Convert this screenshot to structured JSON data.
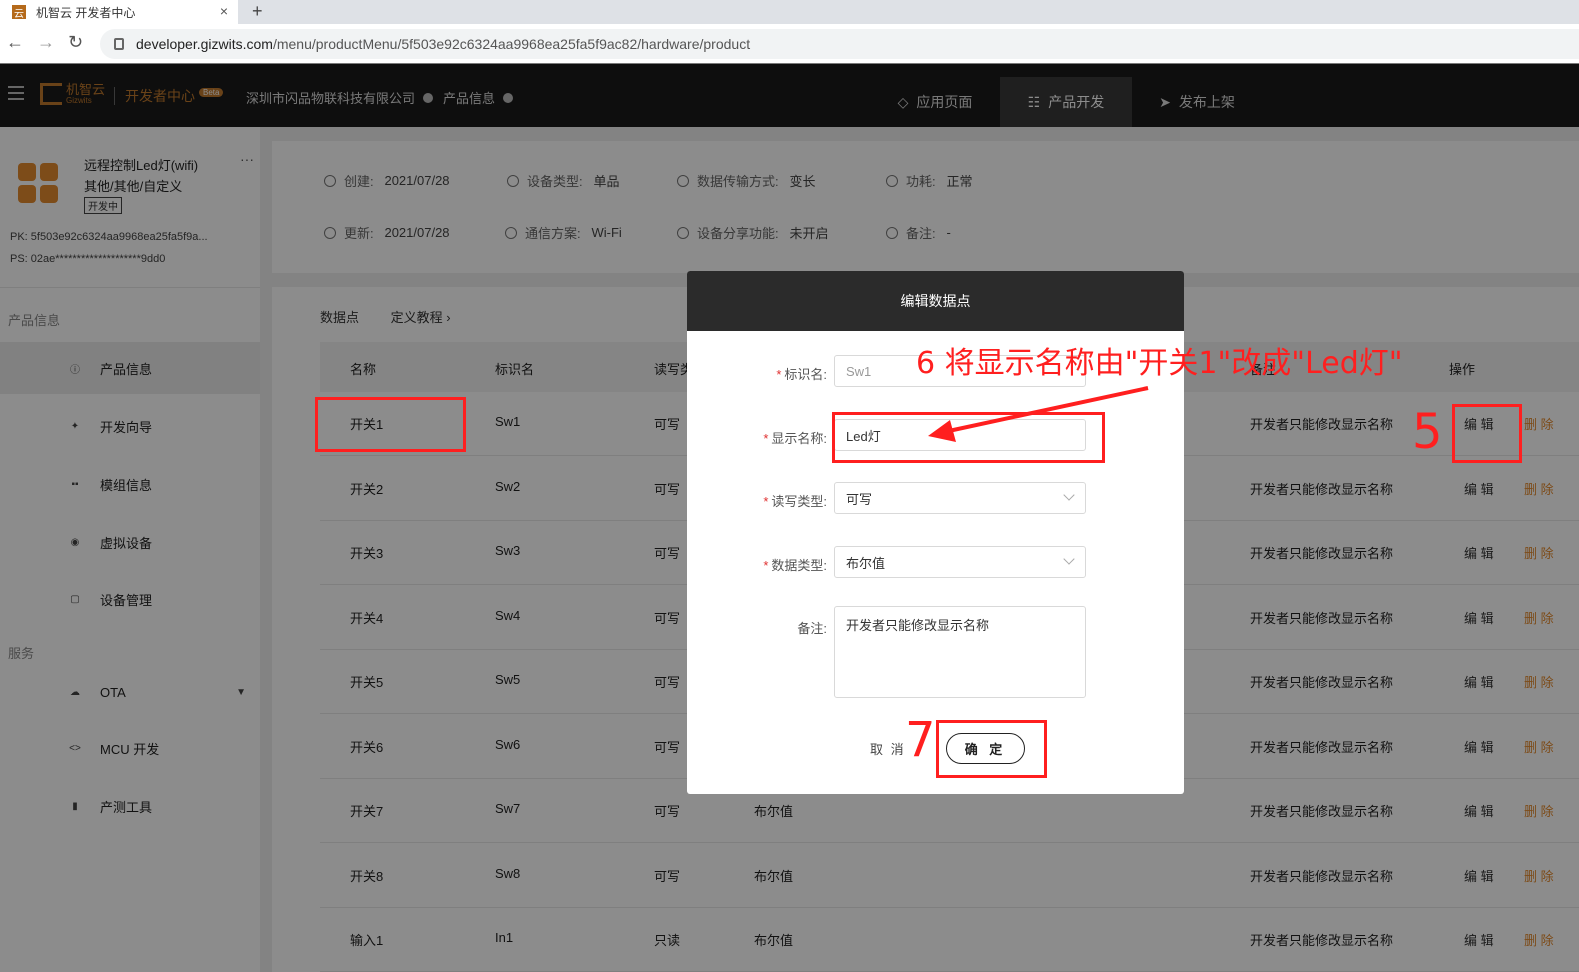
{
  "browser": {
    "tab_title": "机智云 开发者中心",
    "tab_close": "×",
    "new_tab": "+",
    "url_host": "developer.gizwits.com",
    "url_path": "/menu/productMenu/5f503e92c6324aa9968ea25fa5f9ac82/hardware/product"
  },
  "header": {
    "logo_text": "机智云",
    "logo_sub": "Gizwits",
    "dev_center": "开发者中心",
    "beta": "Beta",
    "company": "深圳市闪品物联科技有限公司",
    "product_info": "产品信息",
    "nav": [
      {
        "label": "应用页面",
        "icon": "diamond-icon"
      },
      {
        "label": "产品开发",
        "icon": "sliders-icon"
      },
      {
        "label": "发布上架",
        "icon": "send-icon"
      }
    ]
  },
  "sidebar": {
    "product_name": "远程控制Led灯(wifi)",
    "product_category": "其他/其他/自定义",
    "product_status": "开发中",
    "more": "···",
    "pk": "PK: 5f503e92c6324aa9968ea25fa5f9a...",
    "ps": "PS: 02ae********************9dd0",
    "section_product": "产品信息",
    "section_service": "服务",
    "items": [
      {
        "label": "产品信息",
        "icon": "info-icon"
      },
      {
        "label": "开发向导",
        "icon": "pin-icon"
      },
      {
        "label": "模组信息",
        "icon": "module-icon"
      },
      {
        "label": "虚拟设备",
        "icon": "virtual-icon"
      },
      {
        "label": "设备管理",
        "icon": "device-icon"
      },
      {
        "label": "OTA",
        "icon": "cloud-icon"
      },
      {
        "label": "MCU 开发",
        "icon": "code-icon"
      },
      {
        "label": "产测工具",
        "icon": "tool-icon"
      }
    ]
  },
  "info": {
    "created_k": "创建:",
    "created_v": "2021/07/28",
    "updated_k": "更新:",
    "updated_v": "2021/07/28",
    "device_type_k": "设备类型:",
    "device_type_v": "单品",
    "comm_k": "通信方案:",
    "comm_v": "Wi-Fi",
    "transfer_k": "数据传输方式:",
    "transfer_v": "变长",
    "share_k": "设备分享功能:",
    "share_v": "未开启",
    "power_k": "功耗:",
    "power_v": "正常",
    "note_k": "备注:",
    "note_v": "-"
  },
  "table": {
    "tabs": [
      "数据点",
      "定义教程 ›"
    ],
    "headers": {
      "name": "名称",
      "id": "标识名",
      "rw": "读写类",
      "remark": "备注",
      "op": "操作"
    },
    "rows": [
      {
        "name": "开关1",
        "id": "Sw1",
        "rw": "可写",
        "type": "",
        "remark": "开发者只能修改显示名称"
      },
      {
        "name": "开关2",
        "id": "Sw2",
        "rw": "可写",
        "type": "",
        "remark": "开发者只能修改显示名称"
      },
      {
        "name": "开关3",
        "id": "Sw3",
        "rw": "可写",
        "type": "",
        "remark": "开发者只能修改显示名称"
      },
      {
        "name": "开关4",
        "id": "Sw4",
        "rw": "可写",
        "type": "",
        "remark": "开发者只能修改显示名称"
      },
      {
        "name": "开关5",
        "id": "Sw5",
        "rw": "可写",
        "type": "",
        "remark": "开发者只能修改显示名称"
      },
      {
        "name": "开关6",
        "id": "Sw6",
        "rw": "可写",
        "type": "",
        "remark": "开发者只能修改显示名称"
      },
      {
        "name": "开关7",
        "id": "Sw7",
        "rw": "可写",
        "type": "布尔值",
        "remark": "开发者只能修改显示名称"
      },
      {
        "name": "开关8",
        "id": "Sw8",
        "rw": "可写",
        "type": "布尔值",
        "remark": "开发者只能修改显示名称"
      },
      {
        "name": "输入1",
        "id": "In1",
        "rw": "只读",
        "type": "布尔值",
        "remark": "开发者只能修改显示名称"
      }
    ],
    "edit_label": "编 辑",
    "delete_label": "删 除"
  },
  "modal": {
    "title": "编辑数据点",
    "id_label": "标识名:",
    "id_value": "Sw1",
    "display_label": "显示名称:",
    "display_value": "Led灯",
    "rw_label": "读写类型:",
    "rw_value": "可写",
    "dtype_label": "数据类型:",
    "dtype_value": "布尔值",
    "note_label": "备注:",
    "note_value": "开发者只能修改显示名称",
    "cancel": "取 消",
    "ok": "确 定"
  },
  "annotations": {
    "step5": "5",
    "step6": "6 将显示名称由\"开关1\"改成\"Led灯\"",
    "step7": "7"
  }
}
